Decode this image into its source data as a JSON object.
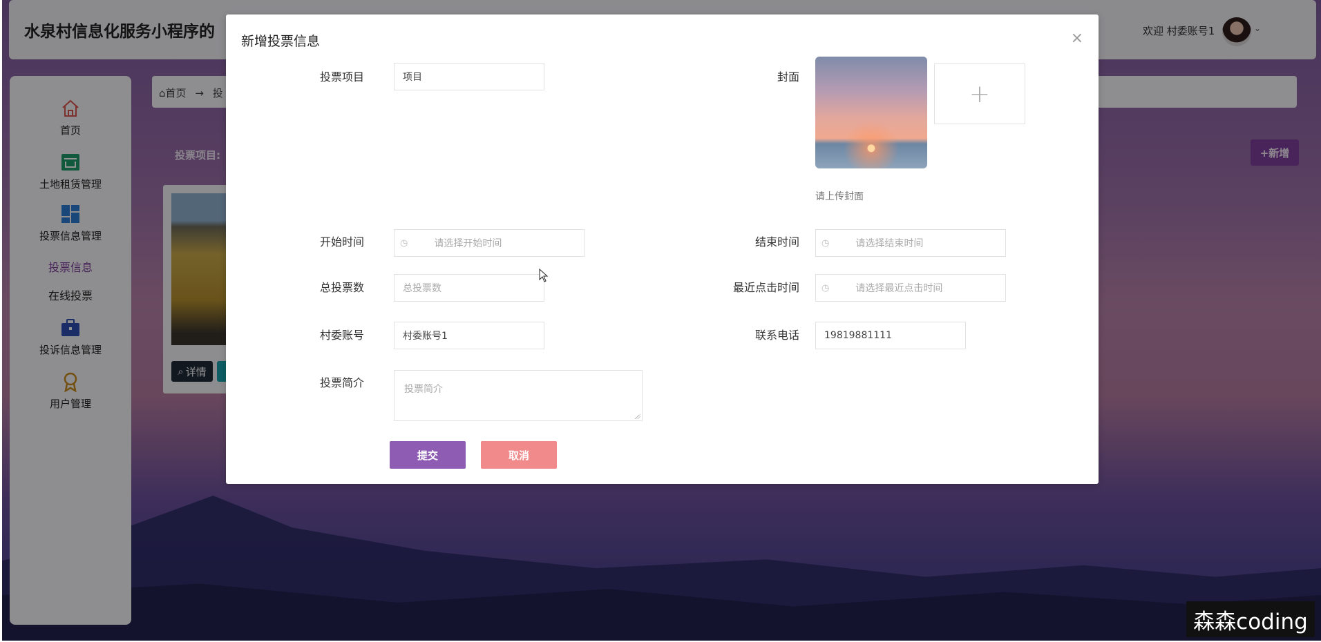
{
  "app": {
    "title": "水泉村信息化服务小程序的",
    "welcome": "欢迎 村委账号1"
  },
  "sidebar": {
    "items": [
      {
        "label": "首页",
        "icon": "home-icon"
      },
      {
        "label": "土地租赁管理",
        "icon": "shop-icon"
      },
      {
        "label": "投票信息管理",
        "icon": "dashboard-icon"
      },
      {
        "label": "投诉信息管理",
        "icon": "briefcase-icon"
      },
      {
        "label": "用户管理",
        "icon": "medal-icon"
      }
    ],
    "sub_items": [
      {
        "label": "投票信息",
        "active": true
      },
      {
        "label": "在线投票",
        "active": false
      }
    ]
  },
  "breadcrumb": {
    "home": "首页",
    "arrow": "→",
    "current": "投"
  },
  "search": {
    "label": "投票项目:"
  },
  "toolbar": {
    "add_label": "+新增"
  },
  "card": {
    "detail_label": "详情"
  },
  "modal": {
    "title": "新增投票信息",
    "close": "×",
    "fields": {
      "project": {
        "label": "投票项目",
        "value": "项目"
      },
      "cover": {
        "label": "封面",
        "hint": "请上传封面",
        "add": "+"
      },
      "start_time": {
        "label": "开始时间",
        "placeholder": "请选择开始时间"
      },
      "end_time": {
        "label": "结束时间",
        "placeholder": "请选择结束时间"
      },
      "total_votes": {
        "label": "总投票数",
        "placeholder": "总投票数"
      },
      "last_click": {
        "label": "最近点击时间",
        "placeholder": "请选择最近点击时间"
      },
      "account": {
        "label": "村委账号",
        "value": "村委账号1"
      },
      "phone": {
        "label": "联系电话",
        "value": "19819881111"
      },
      "intro": {
        "label": "投票简介",
        "placeholder": "投票简介"
      }
    },
    "submit": "提交",
    "cancel": "取消"
  },
  "watermark": "森森coding",
  "colors": {
    "primary": "#8e5cb3",
    "cancel": "#f08a8b",
    "active_nav": "#7e3f9c"
  }
}
